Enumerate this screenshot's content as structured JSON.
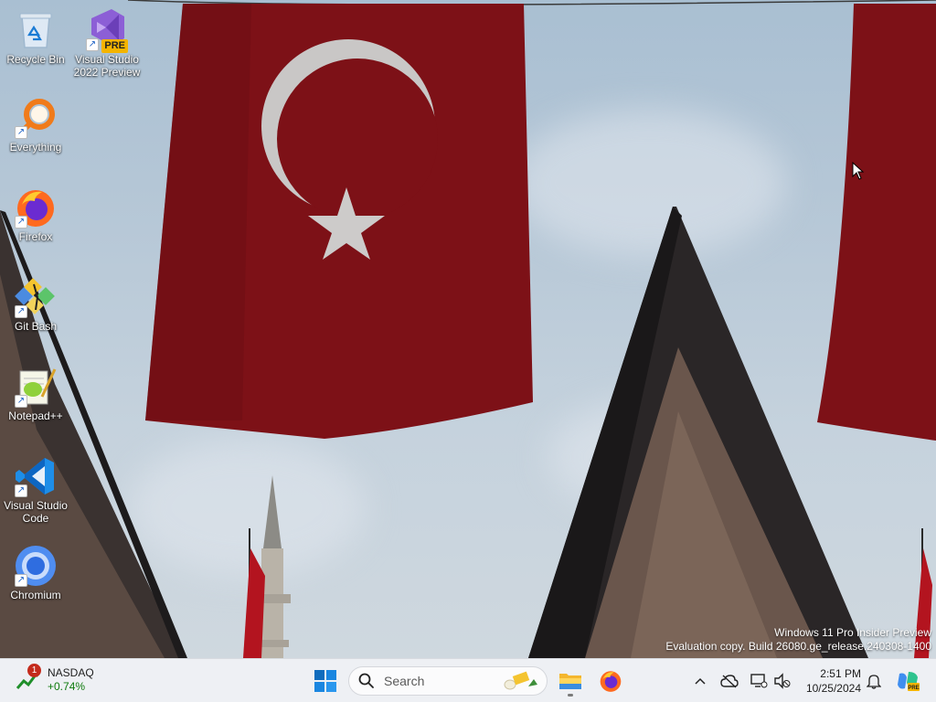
{
  "desktop": {
    "icons": [
      {
        "label": "Recycle Bin",
        "icon": "recycle-bin-icon",
        "shortcut": false
      },
      {
        "label": "Visual Studio 2022 Preview",
        "icon": "visual-studio-preview-icon",
        "badge": "PRE",
        "shortcut": true
      },
      {
        "label": "Everything",
        "icon": "everything-search-icon",
        "shortcut": true
      },
      {
        "label": "Firefox",
        "icon": "firefox-icon",
        "shortcut": true
      },
      {
        "label": "Git Bash",
        "icon": "git-bash-icon",
        "shortcut": true
      },
      {
        "label": "Notepad++",
        "icon": "notepad-plus-plus-icon",
        "shortcut": true
      },
      {
        "label": "Visual Studio Code",
        "icon": "vscode-icon",
        "shortcut": true
      },
      {
        "label": "Chromium",
        "icon": "chromium-icon",
        "shortcut": true
      }
    ],
    "watermark": {
      "line1": "Windows 11 Pro Insider Preview",
      "line2": "Evaluation copy. Build 26080.ge_release.240308-1400"
    }
  },
  "taskbar": {
    "widget": {
      "title": "NASDAQ",
      "change": "+0.74%",
      "badge": "1"
    },
    "search": {
      "placeholder": "Search"
    },
    "pinned": [
      "start-button",
      "file-explorer",
      "firefox"
    ],
    "clock": {
      "time": "2:51 PM",
      "date": "10/25/2024"
    }
  },
  "colors": {
    "flag_red": "#7d1117",
    "taskbar_bg": "#eef0f4",
    "accent": "#0067c0"
  }
}
